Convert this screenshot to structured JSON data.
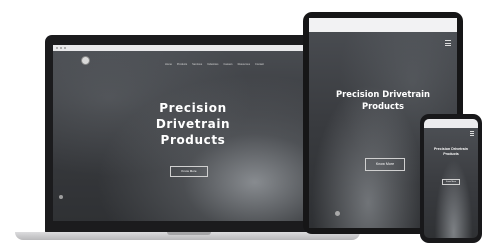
{
  "laptop": {
    "menu": [
      "Home",
      "Products",
      "Services",
      "Industries",
      "Careers",
      "Resources",
      "Contact"
    ],
    "hero_title_line1": "Precision",
    "hero_title_line2": "Drivetrain",
    "hero_title_line3": "Products",
    "hero_text": "",
    "button_label": "Know More"
  },
  "tablet": {
    "url": "",
    "tab": "",
    "hero_title_line1": "Precision Drivetrain",
    "hero_title_line2": "Products",
    "hero_text": "",
    "button_label": "Know More"
  },
  "phone": {
    "hero_title_line1": "Precision Drivetrain",
    "hero_title_line2": "Products",
    "hero_text": "",
    "button_label": "Know More"
  }
}
